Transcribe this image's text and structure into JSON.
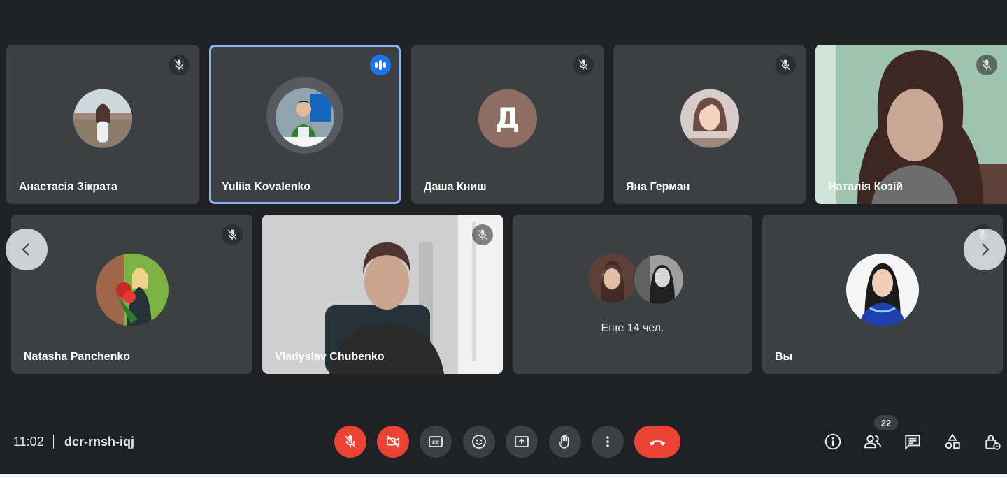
{
  "participants_row1": [
    {
      "name": "Анастасія Зікрата",
      "muted": true
    },
    {
      "name": "Yuliia Kovalenko",
      "speaking": true
    },
    {
      "name": "Даша Книш",
      "muted": true,
      "initial": "Д"
    },
    {
      "name": "Яна Герман",
      "muted": true
    },
    {
      "name": "Наталія Козій",
      "muted": true,
      "video": true
    }
  ],
  "participants_row2": [
    {
      "name": "Natasha Panchenko",
      "muted": true
    },
    {
      "name": "Vladyslav Chubenko",
      "muted": true,
      "video": true
    },
    {
      "more_label": "Ещё 14 чел."
    },
    {
      "name": "Вы",
      "muted": true
    }
  ],
  "meeting": {
    "time": "11:02",
    "code": "dcr-rnsh-iqj",
    "participant_count": "22"
  },
  "controls": {
    "icons": [
      "mic-off-icon",
      "camera-off-icon",
      "captions-icon",
      "emoji-icon",
      "present-icon",
      "raise-hand-icon",
      "more-options-icon",
      "hang-up-icon"
    ],
    "right_icons": [
      "info-icon",
      "people-icon",
      "chat-icon",
      "activities-icon",
      "host-controls-icon"
    ]
  },
  "colors": {
    "background": "#202124",
    "tile": "#3c4043",
    "active_speaker_border": "#8ab4f8",
    "danger": "#ea4335",
    "speaking_indicator": "#1a73e8"
  }
}
